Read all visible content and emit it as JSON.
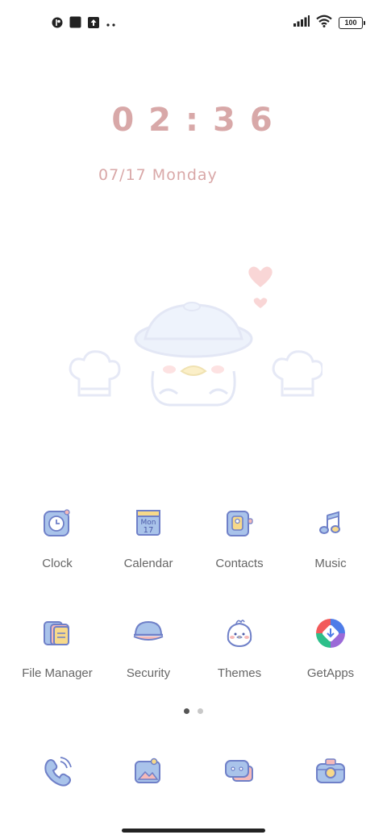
{
  "status_bar": {
    "left_icons": [
      "notification-app-icon",
      "notification-square-icon",
      "upload-icon",
      "more-notifications-icon"
    ],
    "right_icons": [
      "signal-icon",
      "wifi-icon",
      "battery-icon"
    ],
    "battery_level": "100"
  },
  "clock": {
    "time": "02:36",
    "date": "07/17 Monday"
  },
  "apps_row1": [
    {
      "label": "Clock",
      "icon": "clock-icon"
    },
    {
      "label": "Calendar",
      "icon": "calendar-icon",
      "icon_text_month": "Mon",
      "icon_text_day": "17"
    },
    {
      "label": "Contacts",
      "icon": "contacts-icon"
    },
    {
      "label": "Music",
      "icon": "music-icon"
    }
  ],
  "apps_row2": [
    {
      "label": "File Manager",
      "icon": "folder-icon"
    },
    {
      "label": "Security",
      "icon": "security-icon"
    },
    {
      "label": "Themes",
      "icon": "themes-icon"
    },
    {
      "label": "GetApps",
      "icon": "getapps-icon"
    }
  ],
  "page_indicator": {
    "pages": 2,
    "current": 1
  },
  "dock": [
    {
      "icon": "phone-icon"
    },
    {
      "icon": "gallery-icon"
    },
    {
      "icon": "messages-icon"
    },
    {
      "icon": "camera-icon"
    }
  ],
  "colors": {
    "clock_text": "#d8a8a8",
    "icon_blue": "#a9c3ea",
    "icon_stroke": "#6f80c8",
    "accent_yellow": "#f7d98a",
    "accent_pink": "#f5b9b9"
  }
}
